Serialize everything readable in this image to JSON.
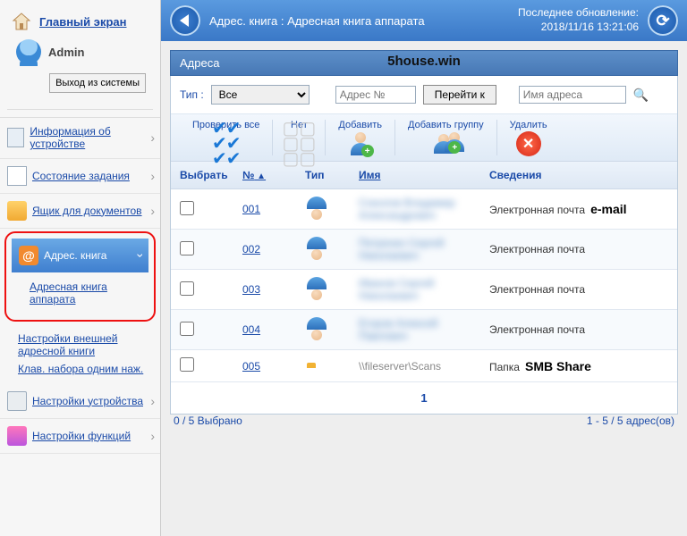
{
  "sidebar": {
    "home_label": "Главный экран",
    "username": "Admin",
    "logout_label": "Выход из системы",
    "items": [
      {
        "label": "Информация об устройстве"
      },
      {
        "label": "Состояние задания"
      },
      {
        "label": "Ящик для документов"
      },
      {
        "label": "Адрес. книга",
        "active": true
      },
      {
        "label": "Настройки устройства"
      },
      {
        "label": "Настройки функций"
      }
    ],
    "address_sub": [
      "Адресная книга аппарата",
      "Настройки внешней адресной книги",
      "Клав. набора одним наж."
    ]
  },
  "header": {
    "breadcrumb": "Адрес. книга : Адресная книга аппарата",
    "last_update_label": "Последнее обновление:",
    "last_update_value": "2018/11/16 13:21:06"
  },
  "watermark": "5house.win",
  "panel": {
    "title": "Адреса",
    "type_label": "Тип :",
    "type_value": "Все",
    "addr_no_placeholder": "Адрес №",
    "go_label": "Перейти к",
    "addr_name_placeholder": "Имя адреса"
  },
  "toolbar": {
    "check_all": "Проверить все",
    "none": "Нет",
    "add": "Добавить",
    "add_group": "Добавить группу",
    "delete": "Удалить"
  },
  "columns": {
    "select": "Выбрать",
    "no": "№",
    "type": "Тип",
    "name": "Имя",
    "details": "Сведения"
  },
  "rows": [
    {
      "no": "001",
      "name": "Соколов Владимир Александрович",
      "details": "Электронная почта",
      "ann": "e-mail",
      "icon": "person"
    },
    {
      "no": "002",
      "name": "Петренко Сергей Николаевич",
      "details": "Электронная почта",
      "icon": "person"
    },
    {
      "no": "003",
      "name": "Иванов Сергей Николаевич",
      "details": "Электронная почта",
      "icon": "person"
    },
    {
      "no": "004",
      "name": "Егоров Алексей Павлович",
      "details": "Электронная почта",
      "icon": "person"
    },
    {
      "no": "005",
      "name": "\\\\fileserver\\Scans",
      "details": "Папка",
      "ann": "SMB Share",
      "icon": "folder",
      "noblur": true
    }
  ],
  "pager": {
    "page": "1"
  },
  "footer": {
    "selected": "0 / 5 Выбрано",
    "count": "1 - 5 / 5 адрес(ов)"
  }
}
